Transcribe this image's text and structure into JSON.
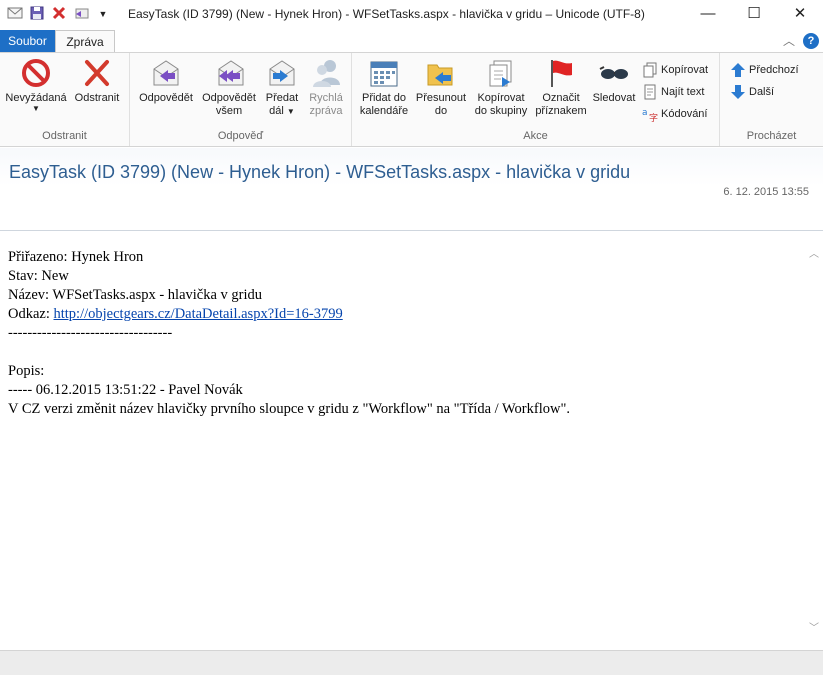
{
  "window": {
    "title": "EasyTask (ID 3799) (New - Hynek Hron) - WFSetTasks.aspx - hlavička v gridu – Unicode (UTF-8)",
    "minimize": "—",
    "maximize": "☐",
    "close": "✕"
  },
  "tabs": {
    "file": "Soubor",
    "message": "Zpráva",
    "help": "?"
  },
  "ribbon": {
    "delete_group": {
      "label": "Odstranit",
      "junk": "Nevyžádaná",
      "delete": "Odstranit"
    },
    "respond_group": {
      "label": "Odpověď",
      "reply": "Odpovědět",
      "reply_all_1": "Odpovědět",
      "reply_all_2": "všem",
      "forward_1": "Předat",
      "forward_2": "dál",
      "im_1": "Rychlá",
      "im_2": "zpráva"
    },
    "actions_group": {
      "label": "Akce",
      "calendar_1": "Přidat do",
      "calendar_2": "kalendáře",
      "move_1": "Přesunout",
      "move_2": "do",
      "copy_group_1": "Kopírovat",
      "copy_group_2": "do skupiny",
      "flag_1": "Označit",
      "flag_2": "příznakem",
      "watch": "Sledovat",
      "copy": "Kopírovat",
      "find": "Najít text",
      "encoding": "Kódování"
    },
    "browse_group": {
      "label": "Procházet",
      "previous": "Předchozí",
      "next": "Další"
    }
  },
  "message": {
    "subject": "EasyTask (ID 3799) (New - Hynek Hron) - WFSetTasks.aspx - hlavička v gridu",
    "date": "6. 12. 2015 13:55",
    "assigned": "Přiřazeno: Hynek Hron",
    "state": "Stav: New",
    "name": "Název: WFSetTasks.aspx - hlavička v gridu",
    "link_label": "Odkaz: ",
    "link": "http://objectgears.cz/DataDetail.aspx?Id=16-3799",
    "separator": "----------------------------------",
    "desc_label": "Popis:",
    "desc_meta": "----- 06.12.2015 13:51:22 - Pavel Novák",
    "desc_text": "V CZ verzi změnit název hlavičky prvního sloupce v gridu z \"Workflow\" na \"Třída / Workflow\"."
  },
  "colors": {
    "file_tab": "#1e6fc6",
    "subject": "#2e5e91",
    "link": "#0645ad"
  }
}
